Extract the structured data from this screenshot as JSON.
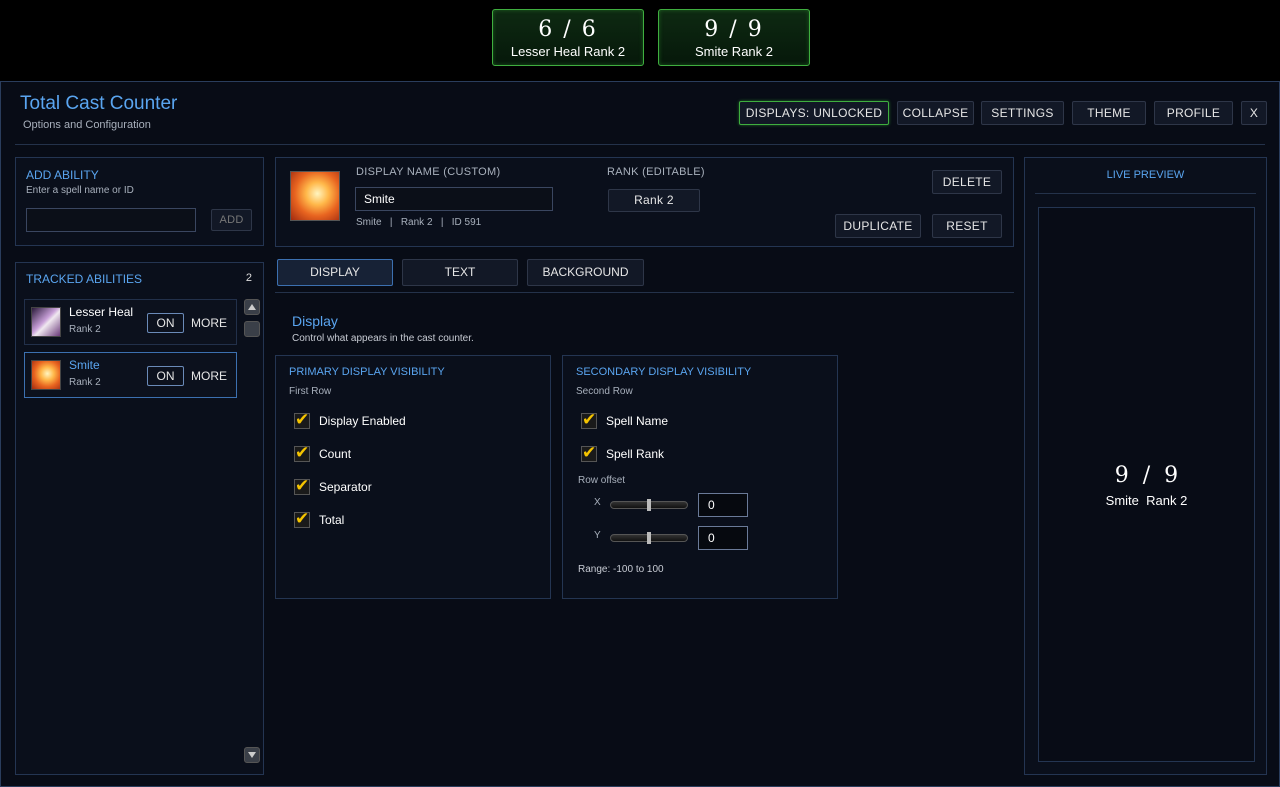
{
  "counters": [
    {
      "count": "6 / 6",
      "label": "Lesser Heal  Rank 2"
    },
    {
      "count": "9  /  9",
      "label": "Smite  Rank 2"
    }
  ],
  "window": {
    "title": "Total Cast Counter",
    "subtitle": "Options and Configuration"
  },
  "toolbar": {
    "displays": "DISPLAYS: UNLOCKED",
    "collapse": "COLLAPSE",
    "settings": "SETTINGS",
    "theme": "THEME",
    "profile": "PROFILE",
    "close": "X"
  },
  "add_ability": {
    "title": "ADD ABILITY",
    "hint": "Enter a spell name or ID",
    "input_value": "",
    "button": "ADD"
  },
  "tracked": {
    "title": "TRACKED ABILITIES",
    "count": "2",
    "items": [
      {
        "name": "Lesser Heal",
        "rank": "Rank 2",
        "toggle": "ON",
        "more": "MORE"
      },
      {
        "name": "Smite",
        "rank": "Rank 2",
        "toggle": "ON",
        "more": "MORE"
      }
    ]
  },
  "editor": {
    "display_name_label": "DISPLAY NAME (CUSTOM)",
    "display_name_value": "Smite",
    "meta": "Smite   |   Rank 2   |   ID 591",
    "rank_label": "RANK (EDITABLE)",
    "rank_value": "Rank 2",
    "delete": "DELETE",
    "duplicate": "DUPLICATE",
    "reset": "RESET"
  },
  "tabs": [
    "DISPLAY",
    "TEXT",
    "BACKGROUND"
  ],
  "display_section": {
    "title": "Display",
    "desc": "Control what appears in the cast counter."
  },
  "primary": {
    "title": "PRIMARY DISPLAY VISIBILITY",
    "sub": "First Row",
    "checks": [
      "Display Enabled",
      "Count",
      "Separator",
      "Total"
    ]
  },
  "secondary": {
    "title": "SECONDARY DISPLAY VISIBILITY",
    "sub": "Second Row",
    "checks": [
      "Spell Name",
      "Spell Rank"
    ],
    "offset_label": "Row offset",
    "x_label": "X",
    "x_value": "0",
    "y_label": "Y",
    "y_value": "0",
    "range": "Range: -100 to 100"
  },
  "preview": {
    "title": "LIVE PREVIEW",
    "count": "9  /  9",
    "label": "Smite  Rank 2"
  },
  "colors": {
    "accent": "#5aa5f0",
    "unlocked": "#3fae3f",
    "check": "#f5c400"
  }
}
